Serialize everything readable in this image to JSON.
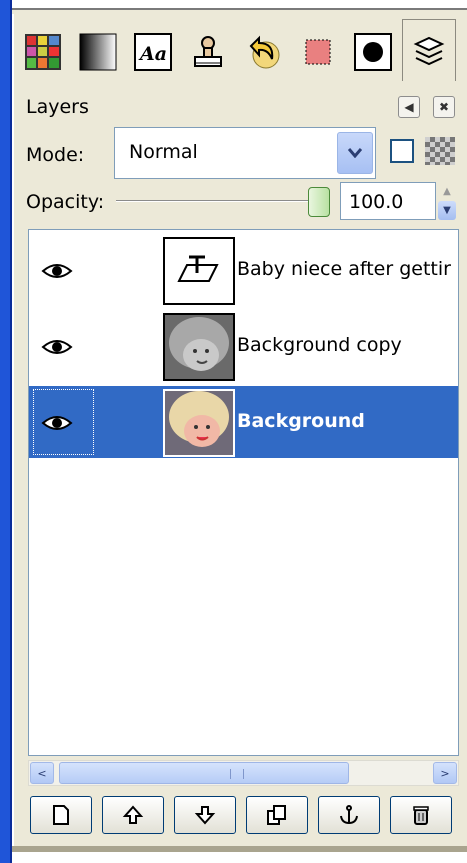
{
  "tabs": [
    {
      "name": "palette-icon",
      "active": false
    },
    {
      "name": "gradient-icon",
      "active": false
    },
    {
      "name": "fonts-icon",
      "active": false
    },
    {
      "name": "stamp-icon",
      "active": false
    },
    {
      "name": "undo-history-icon",
      "active": false
    },
    {
      "name": "selection-icon",
      "active": false
    },
    {
      "name": "brush-dot-icon",
      "active": false
    },
    {
      "name": "layers-icon",
      "active": true
    }
  ],
  "dock": {
    "title": "Layers",
    "mode_label": "Mode:",
    "mode_value": "Normal",
    "opacity_label": "Opacity:",
    "opacity_value": "100.0",
    "opacity_level": 1.0
  },
  "layers": [
    {
      "name": "Baby niece after gettir",
      "type": "text",
      "visible": true,
      "selected": false
    },
    {
      "name": "Background copy",
      "type": "image-gray",
      "visible": true,
      "selected": false
    },
    {
      "name": "Background",
      "type": "image-color",
      "visible": true,
      "selected": true
    }
  ],
  "scrollbar": {
    "left_arrow": "<",
    "right_arrow": ">"
  },
  "buttons": [
    {
      "name": "new-layer-button",
      "icon": "new-document-icon"
    },
    {
      "name": "raise-layer-button",
      "icon": "up-arrow-icon"
    },
    {
      "name": "lower-layer-button",
      "icon": "down-arrow-icon"
    },
    {
      "name": "duplicate-layer-button",
      "icon": "duplicate-icon"
    },
    {
      "name": "anchor-layer-button",
      "icon": "anchor-icon"
    },
    {
      "name": "delete-layer-button",
      "icon": "trash-icon"
    }
  ],
  "colors": {
    "accent": "#316ac5",
    "titlebar": "#1f55d8",
    "panel": "#ece9d8"
  }
}
